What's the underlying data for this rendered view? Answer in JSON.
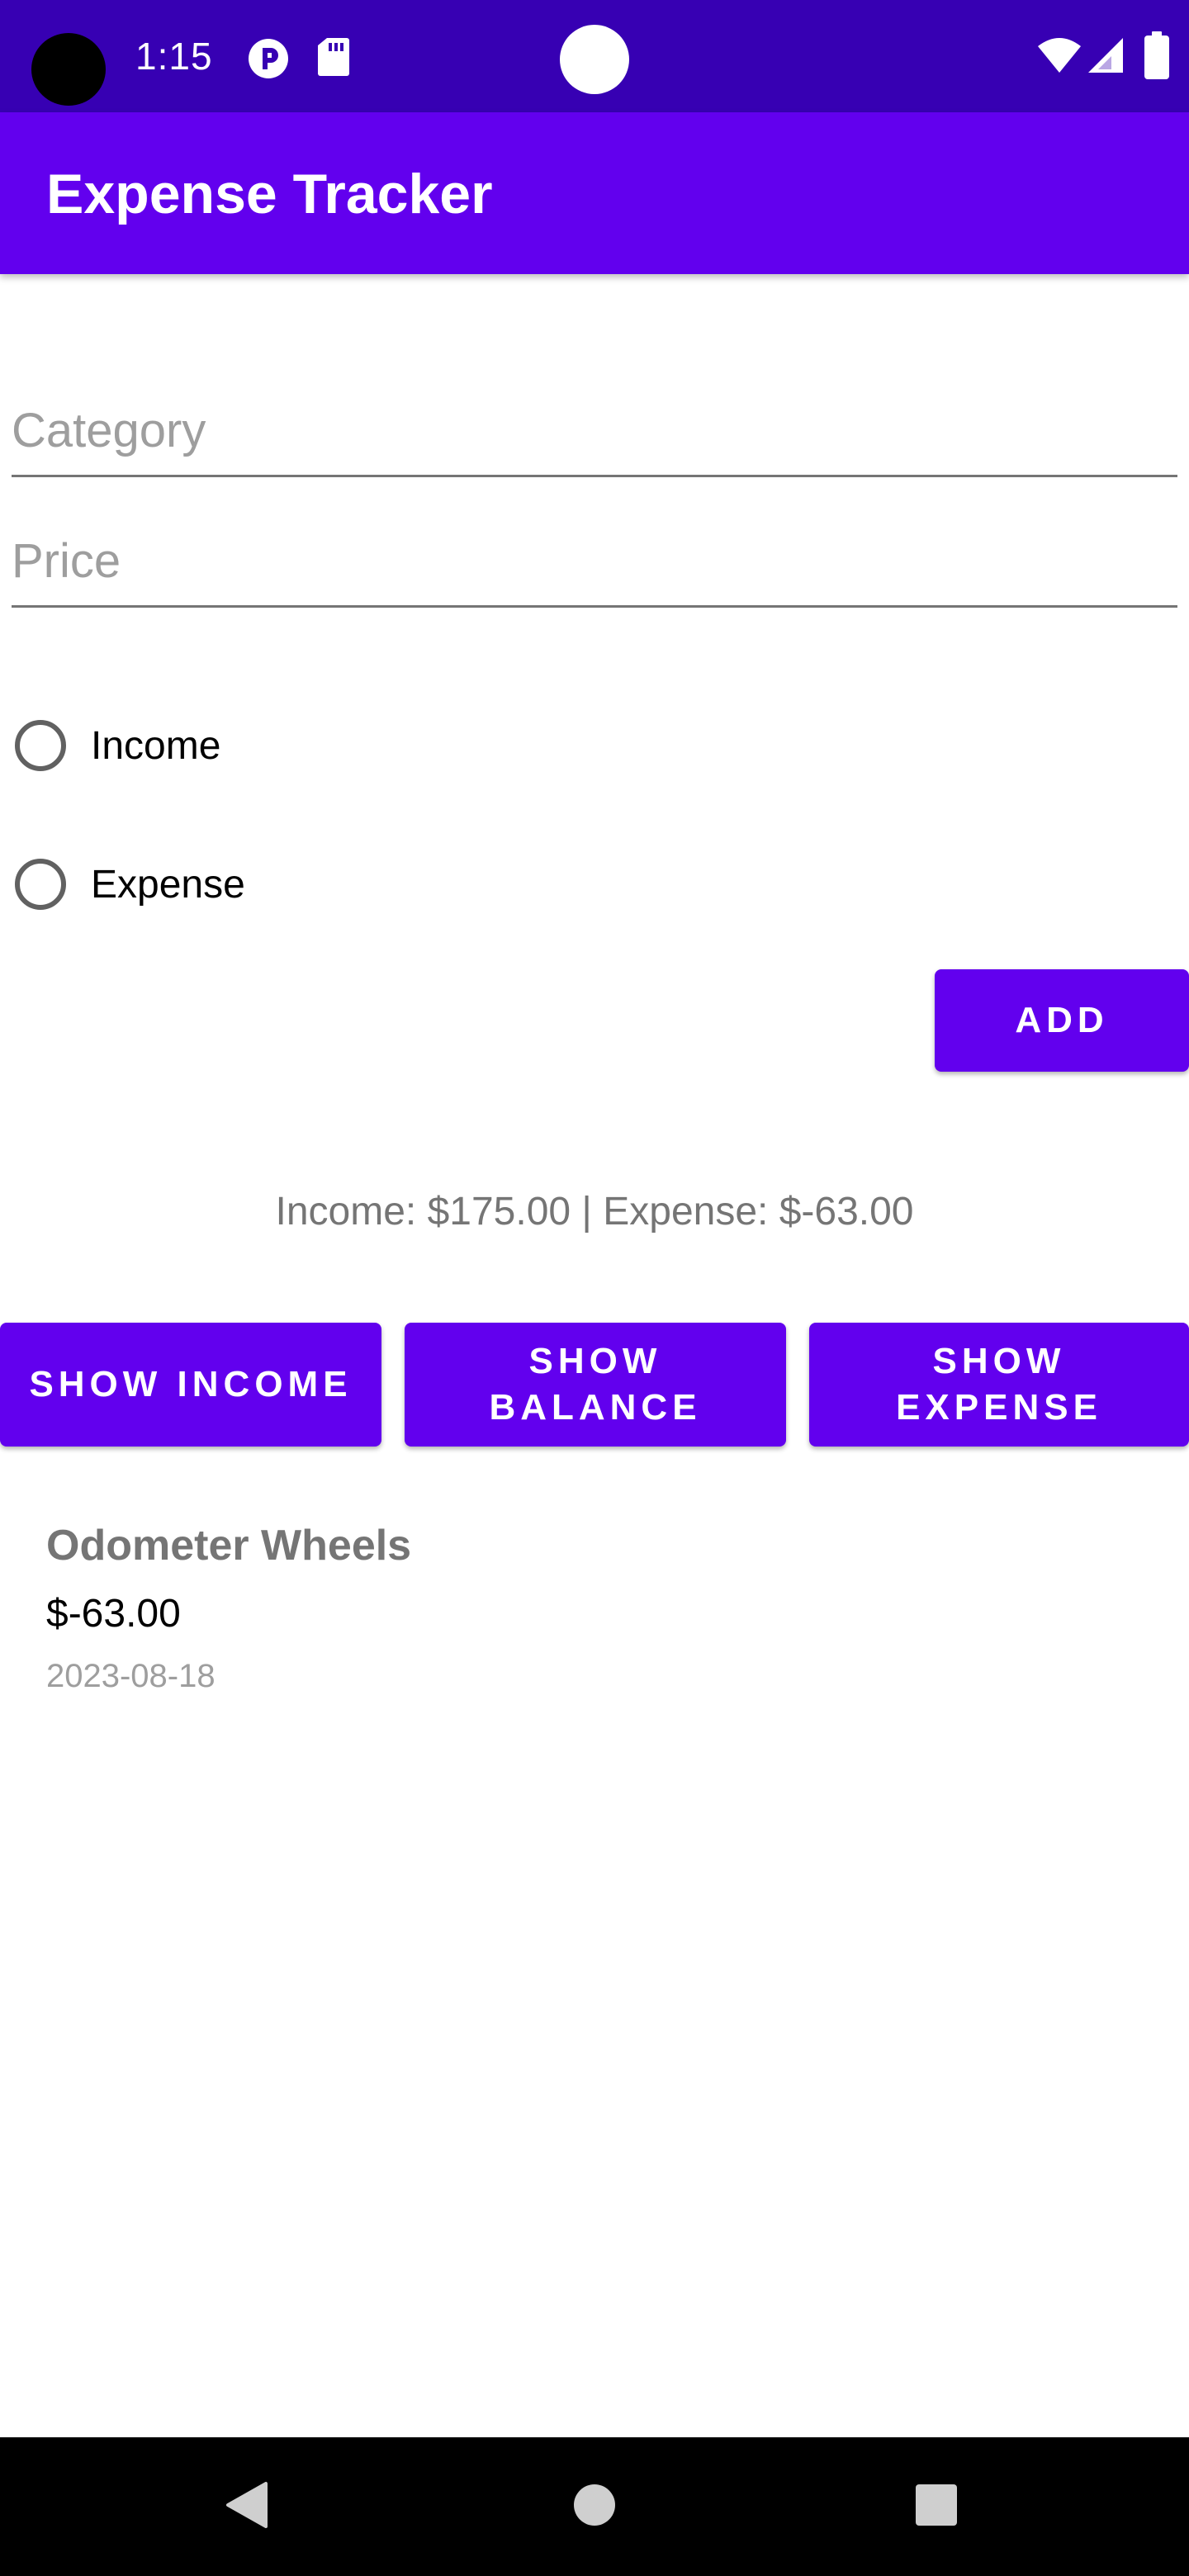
{
  "status_bar": {
    "time": "1:15",
    "icons": [
      "pocket-casts-icon",
      "sd-card-icon",
      "wifi-icon",
      "signal-icon",
      "battery-icon"
    ]
  },
  "app_bar": {
    "title": "Expense Tracker"
  },
  "form": {
    "category_placeholder": "Category",
    "category_value": "",
    "price_placeholder": "Price",
    "price_value": "",
    "radio_income": "Income",
    "radio_expense": "Expense",
    "add_label": "ADD"
  },
  "summary": {
    "text": "Income: $175.00 | Expense: $-63.00"
  },
  "filters": {
    "show_income": "SHOW INCOME",
    "show_balance": "SHOW BALANCE",
    "show_expense": "SHOW EXPENSE"
  },
  "transactions": [
    {
      "category": "Odometer Wheels",
      "amount": "$-63.00",
      "date": "2023-08-18"
    }
  ],
  "nav_bar": {
    "buttons": [
      "back-icon",
      "home-icon",
      "recents-icon"
    ]
  },
  "colors": {
    "status_bar": "#3700b3",
    "primary": "#6200ee",
    "nav_bar": "#000000"
  }
}
